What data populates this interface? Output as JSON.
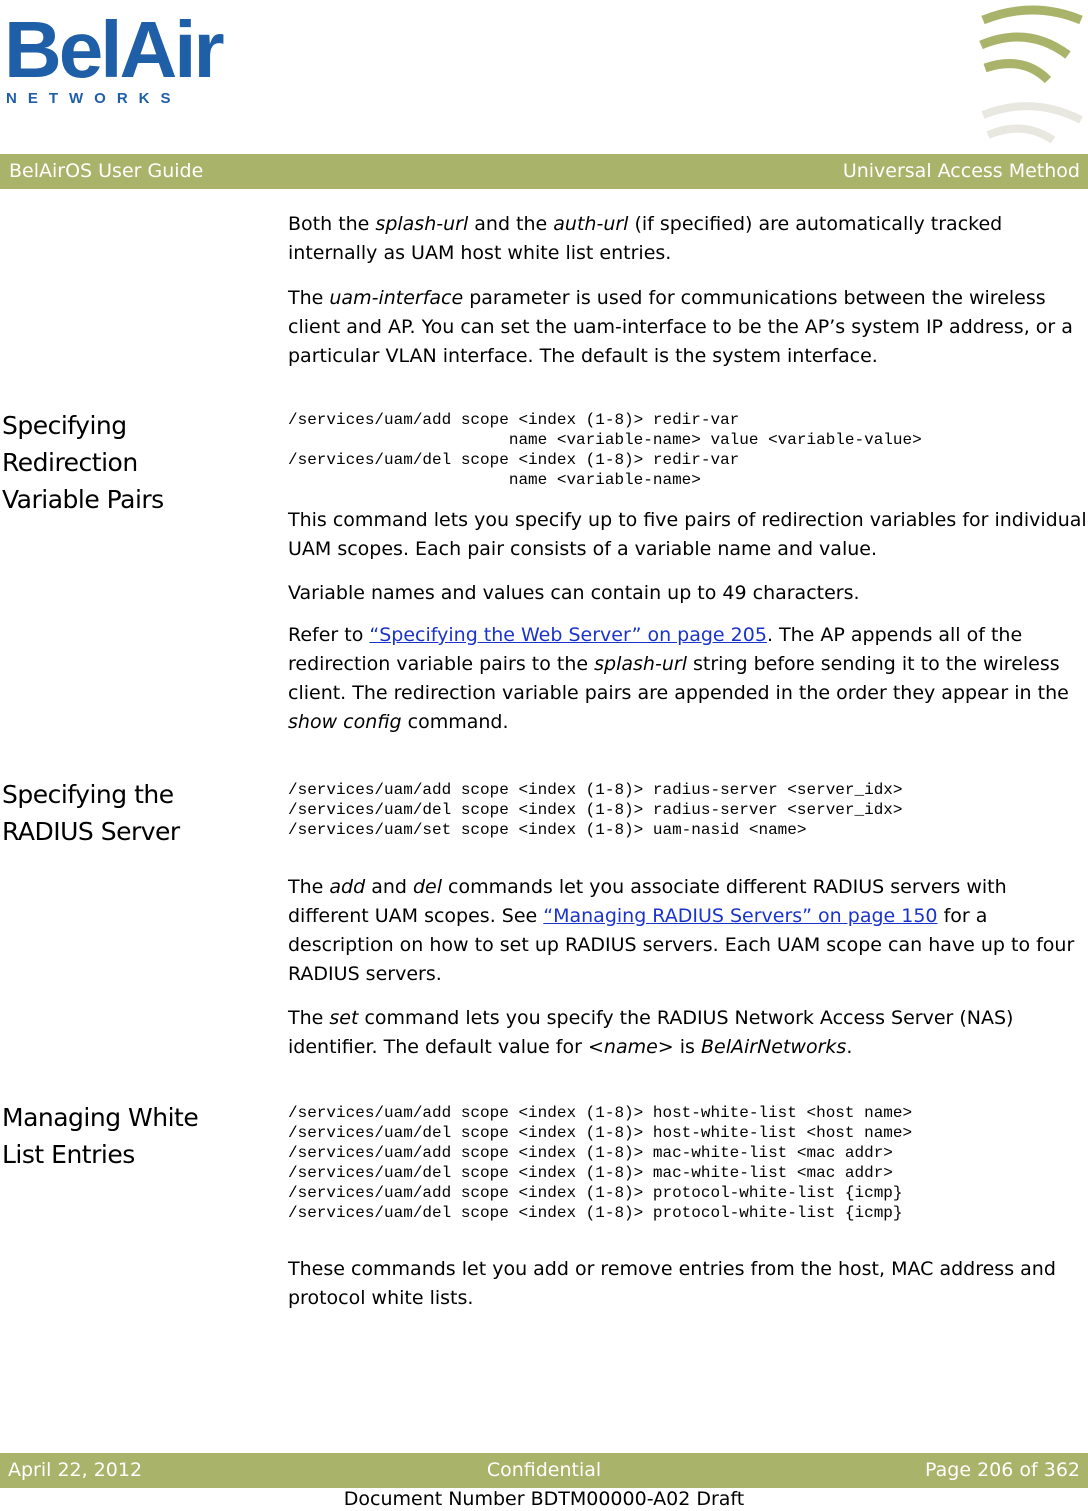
{
  "logo": {
    "brand": "BelAir",
    "sub": "NETWORKS"
  },
  "header": {
    "left": "BelAirOS User Guide",
    "right": "Universal Access Method"
  },
  "intro": {
    "p1": [
      "Both the ",
      "splash-url",
      " and the ",
      "auth-url",
      " (if specified) are automatically tracked internally as UAM host white list entries."
    ],
    "p2": [
      "The ",
      "uam-interface",
      " parameter is used for communications between the wireless client and AP. You can set the uam-interface to be the AP’s system IP address, or a particular VLAN interface. The default is the system interface."
    ]
  },
  "sections": [
    {
      "heading": [
        "Specifying",
        "Redirection",
        "Variable Pairs"
      ],
      "code": "/services/uam/add scope <index (1-8)> redir-var\n                       name <variable-name> value <variable-value>\n/services/uam/del scope <index (1-8)> redir-var\n                       name <variable-name>",
      "p1": "This command lets you specify up to five pairs of redirection variables for individual UAM scopes. Each pair consists of a variable name and value.",
      "p2": "Variable names and values can contain up to 49 characters.",
      "p3": [
        "Refer to ",
        "“Specifying the Web Server” on page 205",
        ". The AP appends all of the redirection variable pairs to the ",
        "splash-url",
        " string before sending it to the wireless client. The redirection variable pairs are appended in the order they appear in the ",
        "show config",
        " command."
      ]
    },
    {
      "heading": [
        "Specifying the",
        "RADIUS Server"
      ],
      "code": "/services/uam/add scope <index (1-8)> radius-server <server_idx>\n/services/uam/del scope <index (1-8)> radius-server <server_idx>\n/services/uam/set scope <index (1-8)> uam-nasid <name>",
      "p1": [
        "The ",
        "add",
        " and ",
        "del",
        " commands let you associate different RADIUS servers with different UAM scopes. See ",
        "“Managing RADIUS Servers” on page 150",
        " for a description on how to set up RADIUS servers. Each UAM scope can have up to four RADIUS servers."
      ],
      "p2": [
        "The ",
        "set",
        " command lets you specify the RADIUS Network Access Server (NAS) identifier. The default value for ",
        "<name>",
        " is ",
        "BelAirNetworks",
        "."
      ]
    },
    {
      "heading": [
        "Managing White",
        "List Entries"
      ],
      "code": "/services/uam/add scope <index (1-8)> host-white-list <host name>\n/services/uam/del scope <index (1-8)> host-white-list <host name>\n/services/uam/add scope <index (1-8)> mac-white-list <mac addr>\n/services/uam/del scope <index (1-8)> mac-white-list <mac addr>\n/services/uam/add scope <index (1-8)> protocol-white-list {icmp}\n/services/uam/del scope <index (1-8)> protocol-white-list {icmp}",
      "p1": "These commands let you add or remove entries from the host, MAC address and protocol white lists."
    }
  ],
  "footer": {
    "date": "April 22, 2012",
    "center": "Confidential",
    "page": "Page 206 of 362",
    "docnum": "Document Number BDTM00000-A02 Draft"
  },
  "colors": {
    "bar": "#a9b36a",
    "brand": "#1f5fa8",
    "link": "#1a33cc"
  }
}
